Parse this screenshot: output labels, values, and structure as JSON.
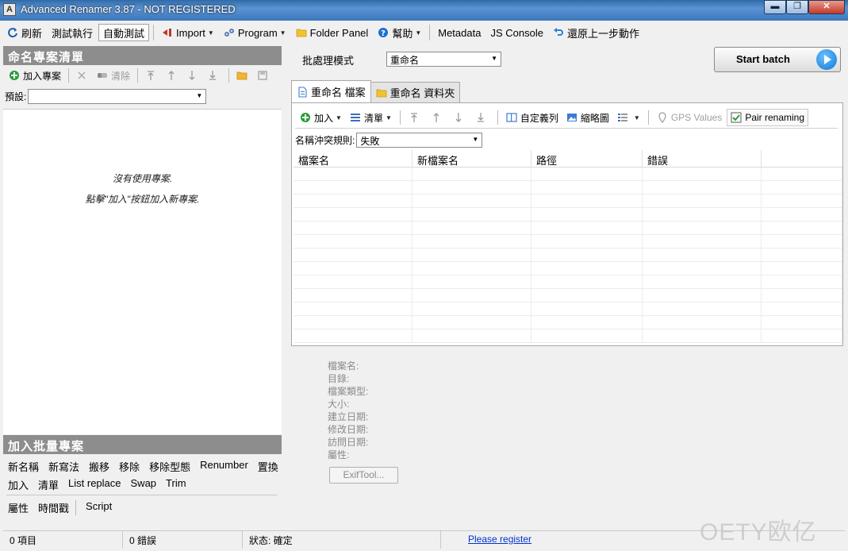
{
  "window": {
    "title": "Advanced Renamer 3.87 - NOT REGISTERED",
    "app_icon": "A"
  },
  "window_buttons": {
    "minimize": "▬",
    "maximize": "❐",
    "close": "✕"
  },
  "toolbar": {
    "refresh": "刷新",
    "test_run": "測試執行",
    "auto_test": "自動測試",
    "import": "Import",
    "program": "Program",
    "folder_panel": "Folder Panel",
    "help": "幫助",
    "metadata": "Metadata",
    "js_console": "JS Console",
    "undo": "還原上一步動作"
  },
  "left_panel": {
    "header": "命名專案清單",
    "add_project": "加入專案",
    "clear": "清除",
    "preset_label": "預設:",
    "preset_value": "",
    "empty_line1": "沒有使用專案.",
    "empty_line2": "點擊\"加入\"按鈕加入新專案."
  },
  "batch_panel": {
    "header": "加入批量專案",
    "row1": [
      "新名稱",
      "新寫法",
      "搬移",
      "移除",
      "移除型態",
      "Renumber",
      "置換"
    ],
    "row2": [
      "加入",
      "清單",
      "List replace",
      "Swap",
      "Trim"
    ],
    "row3": [
      "屬性",
      "時間戳",
      "Script"
    ]
  },
  "batch_mode": {
    "label": "批處理模式",
    "value": "重命名"
  },
  "start_batch": "Start batch",
  "tabs": [
    {
      "label": "重命名 檔案",
      "active": true
    },
    {
      "label": "重命名 資料夾",
      "active": false
    }
  ],
  "file_toolbar": {
    "add": "加入",
    "list": "清單",
    "custom_columns": "自定義列",
    "thumbnails": "縮略圖",
    "gps_values": "GPS Values",
    "pair_renaming": "Pair renaming"
  },
  "conflict": {
    "label": "名稱沖突規則:",
    "value": "失敗"
  },
  "grid": {
    "columns": [
      "檔案名",
      "新檔案名",
      "路徑",
      "錯誤",
      ""
    ]
  },
  "properties": [
    "檔案名:",
    "目錄:",
    "檔案類型:",
    "大小:",
    "建立日期:",
    "修改日期:",
    "訪問日期:",
    "屬性:"
  ],
  "exiftool": "ExifTool...",
  "status": {
    "items": "0 項目",
    "errors": "0 錯誤",
    "state": "狀态: 確定",
    "register": "Please register"
  },
  "watermark": "OETY欧亿",
  "colors": {
    "accent_blue": "#0f79d6",
    "header_gray": "#8d8d8d",
    "add_green": "#2a9d3a"
  }
}
